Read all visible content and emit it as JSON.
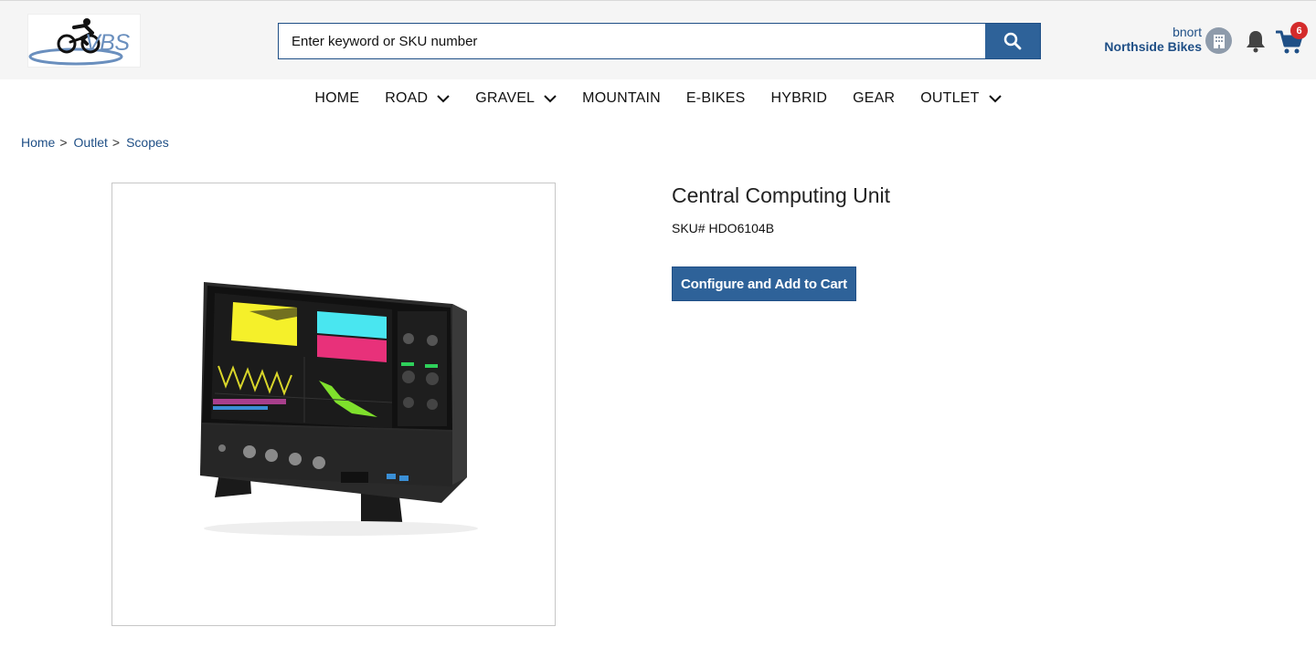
{
  "brand": {
    "logo_text": "VBS"
  },
  "search": {
    "placeholder": "Enter keyword or SKU number"
  },
  "account": {
    "user_name": "bnort",
    "company": "Northside Bikes",
    "cart_count": "6"
  },
  "nav": {
    "items": [
      {
        "label": "HOME",
        "has_dropdown": false
      },
      {
        "label": "ROAD",
        "has_dropdown": true
      },
      {
        "label": "GRAVEL",
        "has_dropdown": true
      },
      {
        "label": "MOUNTAIN",
        "has_dropdown": false
      },
      {
        "label": "E-BIKES",
        "has_dropdown": false
      },
      {
        "label": "HYBRID",
        "has_dropdown": false
      },
      {
        "label": "GEAR",
        "has_dropdown": false
      },
      {
        "label": "OUTLET",
        "has_dropdown": true
      }
    ]
  },
  "breadcrumb": {
    "items": [
      "Home",
      "Outlet",
      "Scopes"
    ],
    "separator": ">"
  },
  "product": {
    "title": "Central Computing Unit",
    "sku": "SKU# HDO6104B",
    "cta_label": "Configure and Add to Cart"
  },
  "colors": {
    "primary": "#2e6299",
    "link": "#1f4f86",
    "badge": "#d42b2b",
    "header_bg": "#f5f5f5"
  }
}
